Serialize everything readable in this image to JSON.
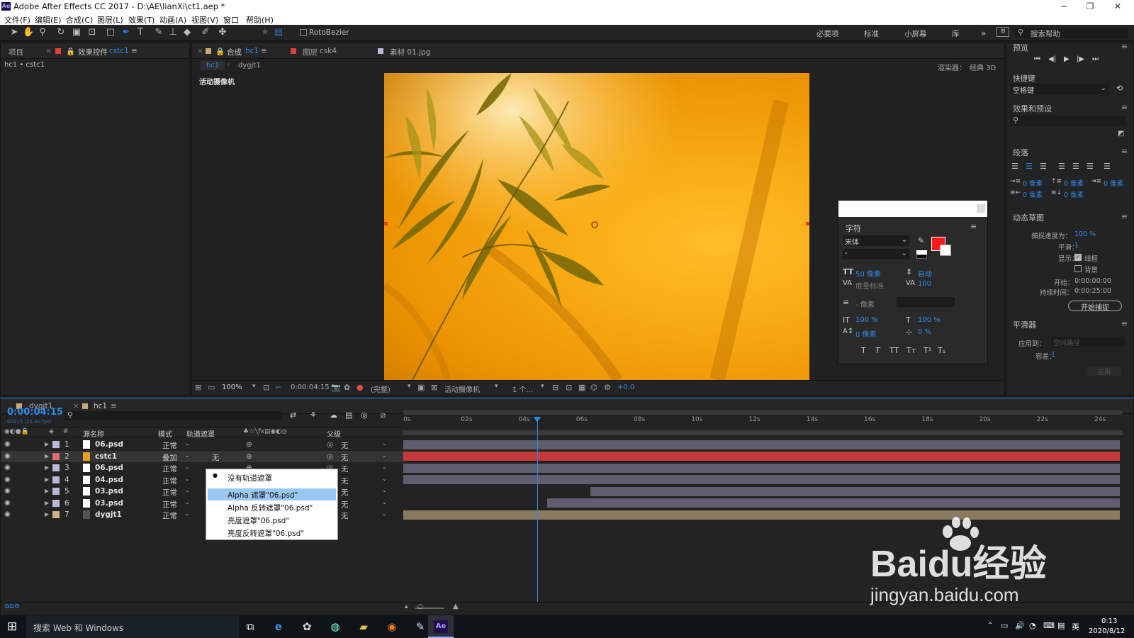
{
  "window": {
    "title": "Adobe After Effects CC 2017 - D:\\AE\\lianXi\\ct1.aep *",
    "app_icon": "Ae"
  },
  "menu": [
    "文件(F)",
    "编辑(E)",
    "合成(C)",
    "图层(L)",
    "效果(T)",
    "动画(A)",
    "视图(V)",
    "窗口",
    "帮助(H)"
  ],
  "toolbar": {
    "rotobezier": "RotoBezier",
    "workspaces": [
      "必要项",
      "标准",
      "小屏幕",
      "库"
    ],
    "search_placeholder": "搜索帮助"
  },
  "project_panel": {
    "tab_project": "项目",
    "tab_effects": "效果控件",
    "tab_effects_target": "cstc1",
    "breadcrumb": "hc1 • cstc1"
  },
  "comp_panel": {
    "tab_comp": "合成",
    "tab_comp_name": "hc1",
    "tab_layer": "图层",
    "tab_layer_name": "csk4",
    "tab_footage": "素材 01.jpg",
    "sub_tabs": [
      "hc1",
      "dygjt1"
    ],
    "renderer_label": "渲染器：",
    "renderer_value": "经典 3D",
    "camera_label": "活动摄像机",
    "footer": {
      "zoom": "100%",
      "time": "0:00:04:15",
      "quality": "(完整)",
      "view": "活动摄像机",
      "views": "1 个...",
      "exposure": "+0.0"
    }
  },
  "character_panel": {
    "title": "字符",
    "font": "宋体",
    "style": "-",
    "size": "50 像素",
    "leading": "自动",
    "kerning": "度量标准",
    "tracking": "100",
    "stroke": "- 像素",
    "vscale": "100 %",
    "hscale": "100 %",
    "baseline": "0 像素",
    "tsume": "0 %",
    "fill_color": "#ff1a1a",
    "style_buttons": [
      "T",
      "T",
      "TT",
      "Tт",
      "T¹",
      "T₁"
    ]
  },
  "preview_panel": {
    "title": "预览",
    "shortcut_label": "快捷键",
    "shortcut_value": "空格键",
    "effects_title": "效果和预设"
  },
  "paragraph_panel": {
    "title": "段落",
    "fields": [
      "0 像素",
      "0 像素",
      "0 像素",
      "0 像素",
      "0 像素"
    ]
  },
  "motion_sketch": {
    "title": "动态草图",
    "capture_speed_label": "捕捉速度为：",
    "capture_speed": "100 %",
    "smoothing_label": "平滑：",
    "smoothing": "1",
    "show_label": "显示：",
    "wireframe": "线框",
    "background": "背景",
    "start_label": "开始：",
    "start": "0:00:00:00",
    "duration_label": "持续时间：",
    "duration": "0:00:25:00",
    "capture_button": "开始捕捉"
  },
  "smoother": {
    "title": "平滑器",
    "apply_label": "应用到：",
    "apply_value": "空间路径",
    "tolerance_label": "容差：",
    "tolerance": "1",
    "apply_button": "应用"
  },
  "timeline": {
    "tabs": [
      "dygjt1",
      "hc1"
    ],
    "timecode": "0:00:04:15",
    "frames": "00115 (25.00 fps)",
    "columns": {
      "source": "源名称",
      "mode": "模式",
      "trkmat": "轨道遮罩",
      "parent": "父级"
    },
    "ruler": [
      "0s",
      "02s",
      "04s",
      "06s",
      "08s",
      "10s",
      "12s",
      "14s",
      "16s",
      "18s",
      "20s",
      "22s",
      "24s"
    ],
    "layers": [
      {
        "num": "1",
        "name": "06.psd",
        "mode": "正常",
        "parent": "无",
        "color": "#b9b9d9",
        "start": 0,
        "end": 1
      },
      {
        "num": "2",
        "name": "cstc1",
        "mode": "叠加",
        "trkmat": "无",
        "parent": "无",
        "color": "#e06a6a",
        "start": 0,
        "end": 1
      },
      {
        "num": "3",
        "name": "06.psd",
        "mode": "正常",
        "parent": "无",
        "color": "#b9b9d9",
        "start": 0,
        "end": 1
      },
      {
        "num": "4",
        "name": "04.psd",
        "mode": "正常",
        "parent": "无",
        "color": "#b9b9d9",
        "start": 0,
        "end": 1
      },
      {
        "num": "5",
        "name": "03.psd",
        "mode": "正常",
        "parent": "无",
        "color": "#b9b9d9",
        "start": 0.26,
        "end": 1
      },
      {
        "num": "6",
        "name": "03.psd",
        "mode": "正常",
        "parent": "无",
        "color": "#b9b9d9",
        "start": 0.2,
        "end": 1
      },
      {
        "num": "7",
        "name": "dygjt1",
        "mode": "正常",
        "parent": "无",
        "color": "#cdb088",
        "start": 0,
        "end": 1
      }
    ],
    "dropdown": [
      "没有轨道遮罩",
      "Alpha 遮罩\"06.psd\"",
      "Alpha 反转遮罩\"06.psd\"",
      "亮度遮罩\"06.psd\"",
      "亮度反转遮罩\"06.psd\""
    ]
  },
  "taskbar": {
    "search": "搜索 Web 和 Windows",
    "time": "0:13",
    "date": "2020/8/12",
    "ime": "英"
  },
  "watermark": {
    "brand": "Baidu经验",
    "url": "jingyan.baidu.com"
  }
}
